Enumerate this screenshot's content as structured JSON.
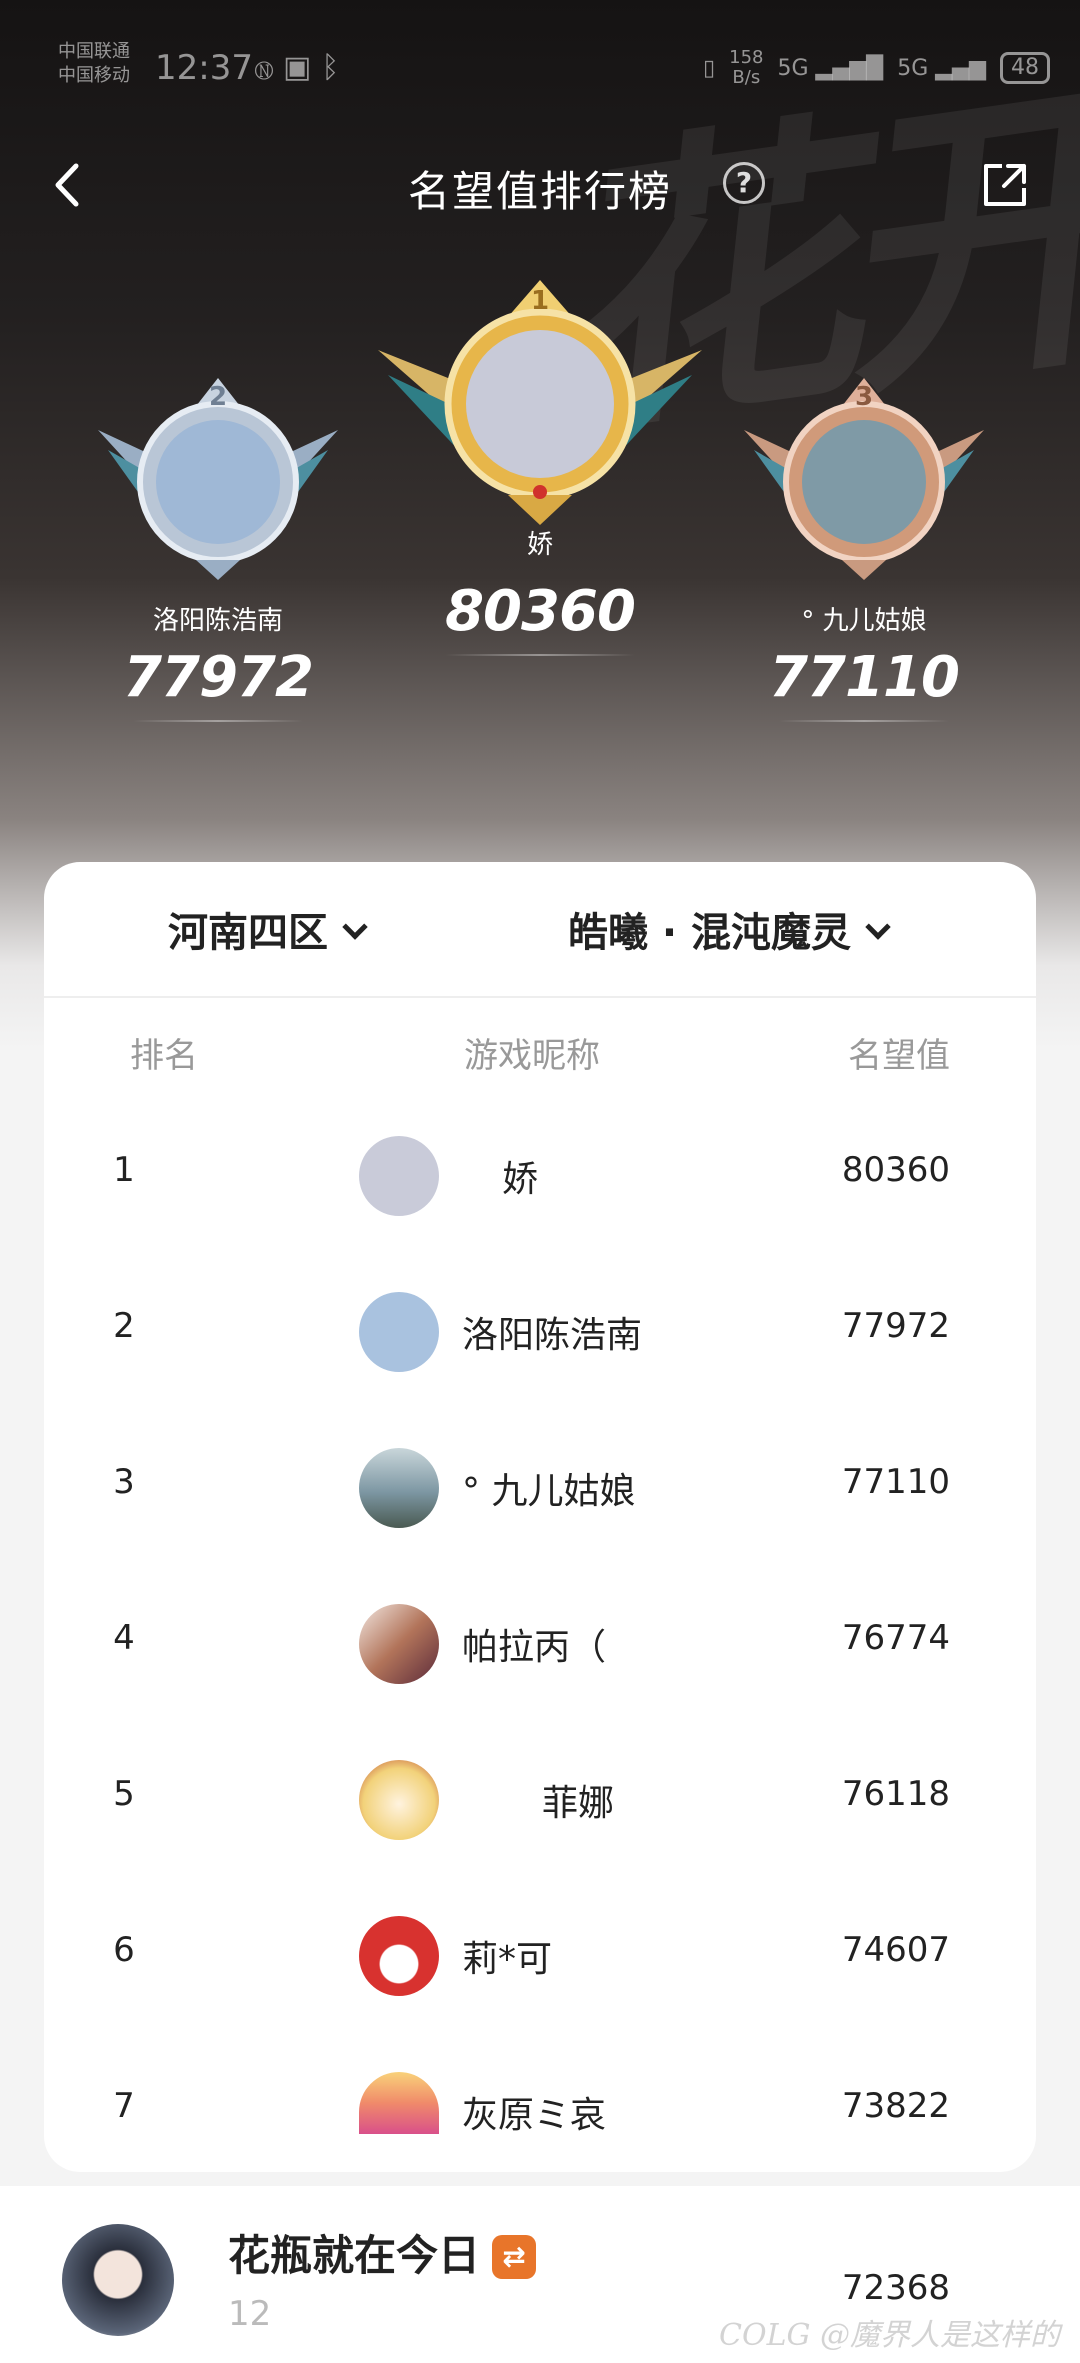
{
  "status_bar": {
    "carrier_line1": "中国联通",
    "carrier_line2": "中国移动",
    "time": "12:37",
    "net_speed_top": "158",
    "net_speed_unit": "B/s",
    "net1": "5G",
    "net2": "5G",
    "battery": "48"
  },
  "header": {
    "title": "名望值排行榜",
    "help_label": "?"
  },
  "podium": [
    {
      "rank": "2",
      "name": "洛阳陈浩南",
      "score": "77972",
      "avatar_color": "#9fb8d6"
    },
    {
      "rank": "1",
      "name": "娇",
      "score": "80360",
      "avatar_color": "#c8cad8"
    },
    {
      "rank": "3",
      "name": "°  九儿姑娘",
      "score": "77110",
      "avatar_color": "#7f9aa6"
    }
  ],
  "filters": {
    "region": "河南四区",
    "class": "皓曦 · 混沌魔灵"
  },
  "table": {
    "headers": [
      "排名",
      "游戏昵称",
      "名望值"
    ],
    "rows": [
      {
        "rank": "1",
        "name": "娇",
        "score": "80360",
        "avatar_color": "#c9cbd9"
      },
      {
        "rank": "2",
        "name": "洛阳陈浩南",
        "score": "77972",
        "avatar_color": "#a9c2df"
      },
      {
        "rank": "3",
        "name": "°  九儿姑娘",
        "score": "77110",
        "avatar_color": "#7d97a3"
      },
      {
        "rank": "4",
        "name": "帕拉丙（",
        "score": "76774",
        "avatar_color": "#b2745a"
      },
      {
        "rank": "5",
        "name": "菲娜",
        "score": "76118",
        "avatar_color": "#f2d27a"
      },
      {
        "rank": "6",
        "name": "莉*可",
        "score": "74607",
        "avatar_color": "#d8322f"
      },
      {
        "rank": "7",
        "name": "灰原ミ哀",
        "score": "73822",
        "avatar_color": "#f08a6a"
      }
    ]
  },
  "me": {
    "name": "花瓶就在今日",
    "tag": "⇄",
    "rank": "12",
    "score": "72368",
    "avatar_color": "#5a6477"
  },
  "watermark": "COLG @魔界人是这样的",
  "colors": {
    "gold": "#e7b64a",
    "silver": "#b9c6d6",
    "bronze": "#d09a7a"
  }
}
